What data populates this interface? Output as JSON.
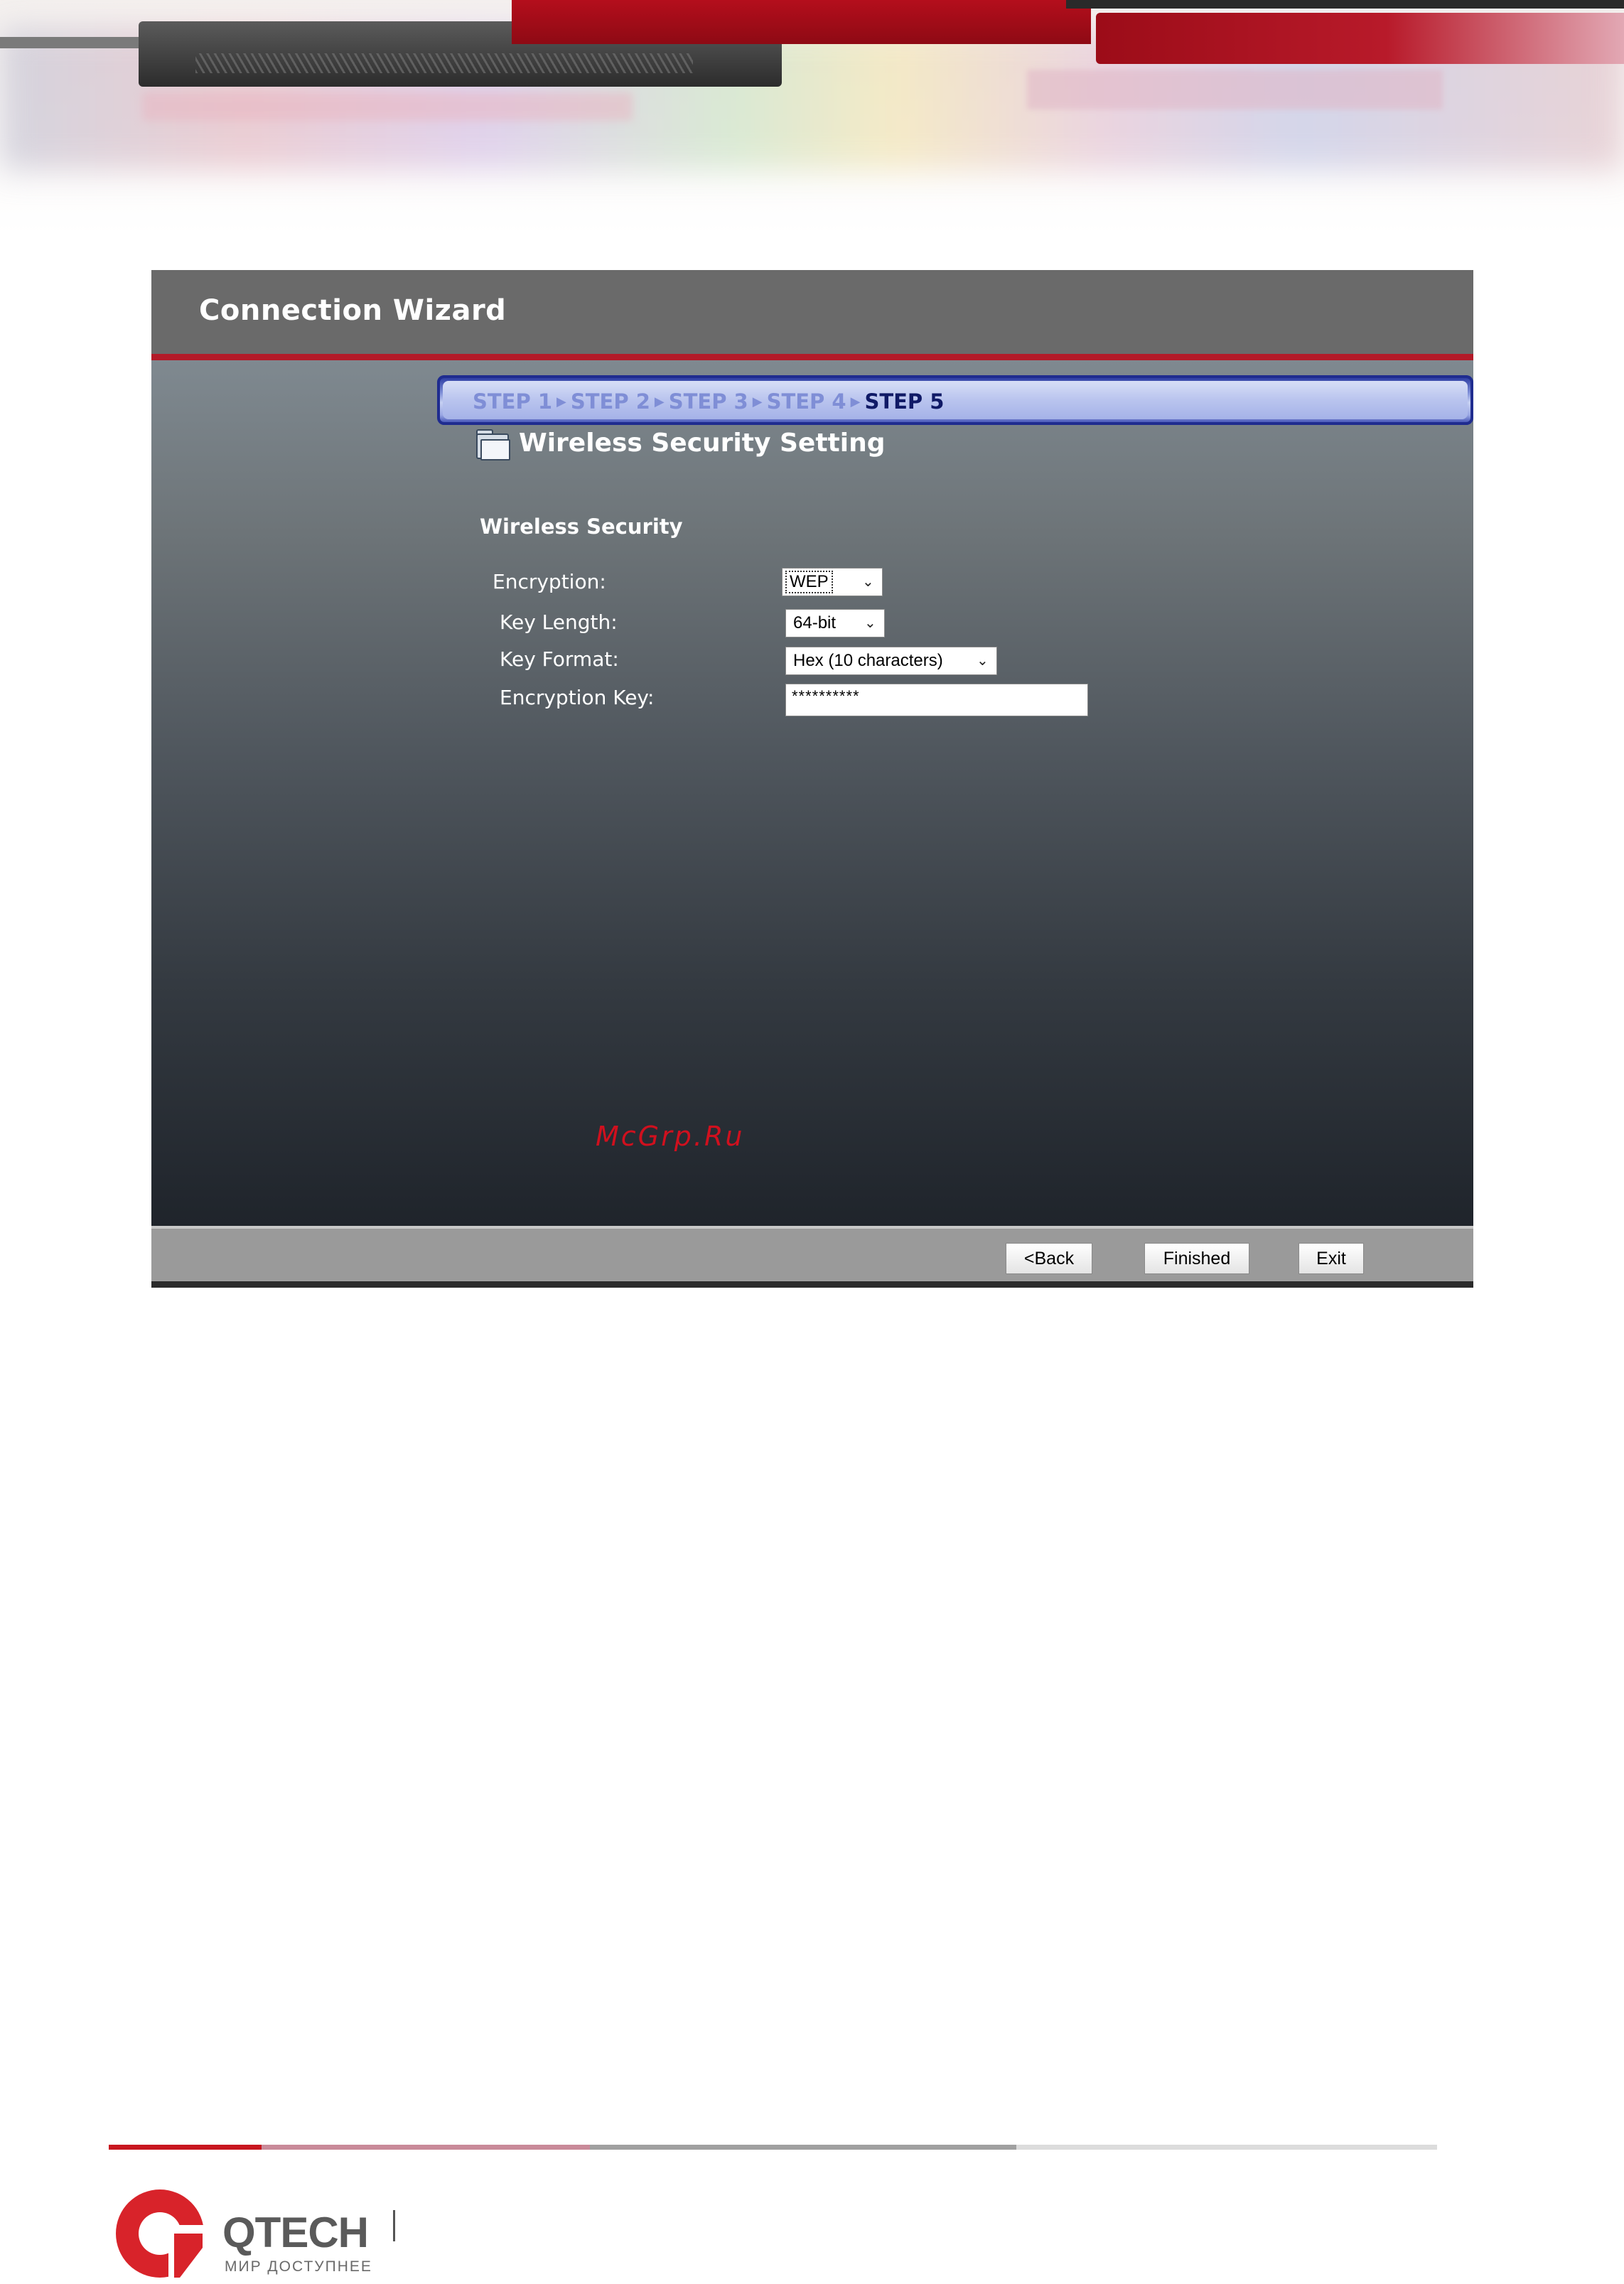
{
  "window": {
    "title": "Connection Wizard"
  },
  "steps": [
    {
      "label": "STEP 1",
      "current": false
    },
    {
      "label": "STEP 2",
      "current": false
    },
    {
      "label": "STEP 3",
      "current": false
    },
    {
      "label": "STEP 4",
      "current": false
    },
    {
      "label": "STEP 5",
      "current": true
    }
  ],
  "section": {
    "title": "Wireless Security Setting",
    "icon": "folder-icon"
  },
  "form": {
    "heading": "Wireless Security",
    "encryption": {
      "label": "Encryption:",
      "value": "WEP"
    },
    "key_length": {
      "label": "Key Length:",
      "value": "64-bit"
    },
    "key_format": {
      "label": "Key Format:",
      "value": "Hex (10 characters)"
    },
    "encryption_key": {
      "label": "Encryption Key:",
      "value": "**********"
    }
  },
  "buttons": {
    "back": "<Back",
    "finished": "Finished",
    "exit": "Exit"
  },
  "watermark": "McGrp.Ru",
  "brand": {
    "name": "QTECH",
    "tagline": "МИР ДОСТУПНЕЕ",
    "accent": "#d8232a"
  },
  "colors": {
    "title_bar": "#6a6a6a",
    "accent_red": "#b31a28",
    "step_current": "#101a66",
    "step_inactive": "#7f8ed6"
  }
}
